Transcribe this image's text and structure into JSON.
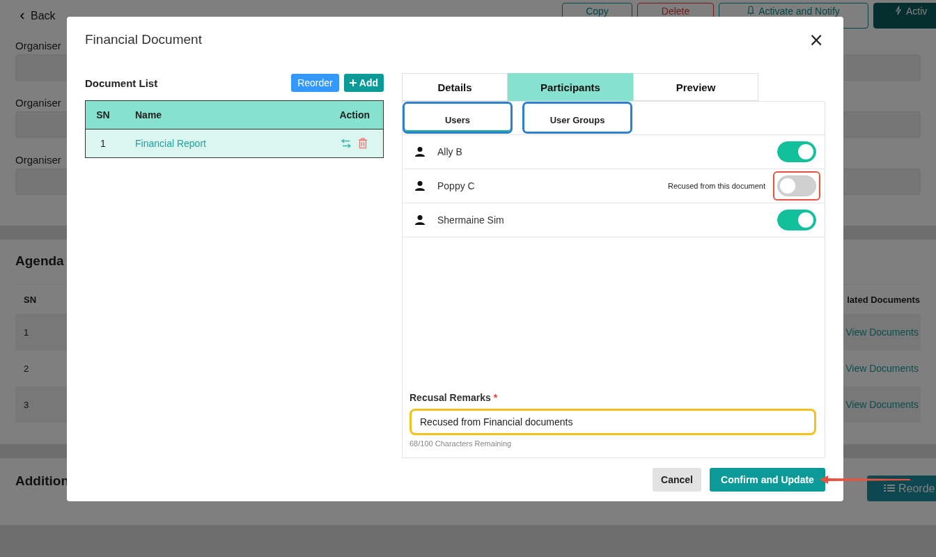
{
  "page": {
    "back": "Back",
    "actions": [
      {
        "label": "Copy",
        "kind": "outline"
      },
      {
        "label": "Delete",
        "kind": "danger"
      },
      {
        "label": "Activate and Notify",
        "kind": "notify"
      },
      {
        "label": "Activ",
        "kind": "primary"
      }
    ],
    "organiser_labels": [
      "Organiser",
      "Organiser",
      "Organiser"
    ],
    "agenda": {
      "title": "Agenda",
      "columns": [
        "SN",
        "lated Documents"
      ],
      "rows": [
        {
          "sn": "1",
          "link": "View Documents"
        },
        {
          "sn": "2",
          "link": "View Documents"
        },
        {
          "sn": "3",
          "link": "View Documents"
        }
      ]
    },
    "additional": {
      "title": "Addition",
      "button": "Reorde"
    }
  },
  "dialog": {
    "title": "Financial Document",
    "close": "×",
    "document_list": {
      "title": "Document List",
      "reorder": "Reorder",
      "add": "Add",
      "columns": [
        "SN",
        "Name",
        "Action"
      ],
      "rows": [
        {
          "sn": "1",
          "name": "Financial Report"
        }
      ]
    },
    "tabs": [
      {
        "label": "Details",
        "selected": false
      },
      {
        "label": "Participants",
        "selected": true
      },
      {
        "label": "Preview",
        "selected": false
      }
    ],
    "subtabs": [
      {
        "label": "Users",
        "selected": true,
        "highlighted": true
      },
      {
        "label": "User Groups",
        "selected": false,
        "highlighted": true
      }
    ],
    "participants": [
      {
        "name": "Ally B",
        "on": true,
        "highlighted": false
      },
      {
        "name": "Poppy C",
        "note": "Recused from this document",
        "on": false,
        "highlighted": true
      },
      {
        "name": "Shermaine Sim",
        "on": true,
        "highlighted": false
      }
    ],
    "remarks": {
      "label": "Recusal Remarks",
      "required": "*",
      "value": "Recused from Financial documents",
      "helper": "68/100 Characters Remaining",
      "highlighted": true
    },
    "cancel": "Cancel",
    "confirm": "Confirm and Update",
    "confirm_pointer": true
  }
}
